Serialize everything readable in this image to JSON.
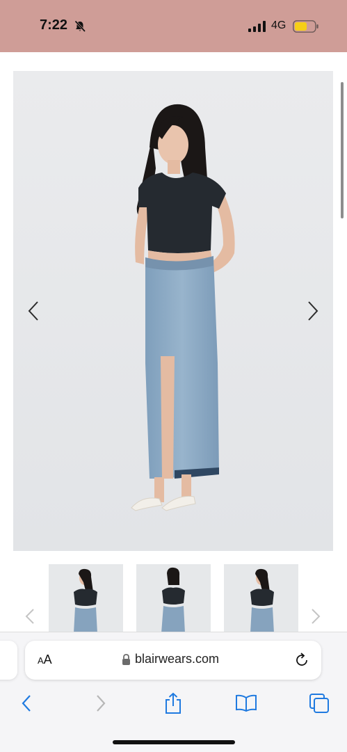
{
  "status_bar": {
    "time": "7:22",
    "network": "4G",
    "background_color": "#cf9d97",
    "icons": [
      "bell-muted-icon",
      "signal-icon",
      "battery-icon"
    ]
  },
  "gallery": {
    "main_image": "model-denim-skirt-front",
    "prev_icon": "chevron-left-icon",
    "next_icon": "chevron-right-icon",
    "thumbnails": [
      "model-thumbnail-1",
      "model-thumbnail-2",
      "model-thumbnail-3"
    ]
  },
  "browser": {
    "text_size_label_small": "A",
    "text_size_label_large": "A",
    "url": "blairwears.com",
    "icons": [
      "lock-icon",
      "reload-icon",
      "back-icon",
      "forward-icon",
      "share-icon",
      "bookmarks-icon",
      "tabs-icon"
    ],
    "accent_color": "#1f7ae0"
  }
}
